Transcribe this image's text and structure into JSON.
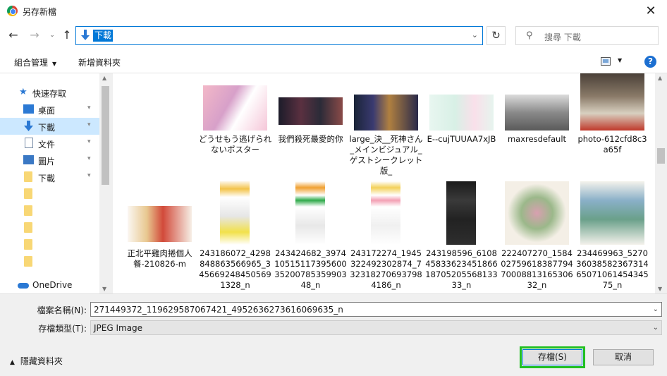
{
  "window": {
    "title": "另存新檔",
    "close_glyph": "✕"
  },
  "nav": {
    "back_glyph": "←",
    "forward_glyph": "→",
    "dropdown_glyph": "⌄",
    "up_glyph": "↑",
    "address": "下載",
    "address_chevron": "⌄",
    "refresh_glyph": "↻",
    "search_icon": "⚲",
    "search_placeholder": "搜尋 下載"
  },
  "toolbar": {
    "organize_label": "組合管理",
    "organize_caret": "▼",
    "new_folder_label": "新增資料夾",
    "view_caret": "▼",
    "help_glyph": "?"
  },
  "sidebar": {
    "items": [
      {
        "label": "快速存取",
        "icon": "star-icon",
        "pinned": false
      },
      {
        "label": "桌面",
        "icon": "desktop-icon",
        "pinned": true
      },
      {
        "label": "下載",
        "icon": "download-icon",
        "pinned": true,
        "selected": true
      },
      {
        "label": "文件",
        "icon": "document-icon",
        "pinned": true
      },
      {
        "label": "圖片",
        "icon": "picture-icon",
        "pinned": true
      },
      {
        "label": "下載",
        "icon": "folder-icon",
        "pinned": true
      },
      {
        "label": "",
        "icon": "folder-icon"
      },
      {
        "label": "",
        "icon": "folder-icon"
      },
      {
        "label": "",
        "icon": "folder-icon"
      },
      {
        "label": "",
        "icon": "folder-icon"
      },
      {
        "label": "",
        "icon": "folder-icon"
      },
      {
        "label": "OneDrive",
        "icon": "cloud-icon"
      }
    ],
    "pin_glyph": "📌"
  },
  "files": {
    "row1": [
      {
        "name": "どうせもう逃げられないポスター"
      },
      {
        "name": "我們殺死最愛的你"
      },
      {
        "name": "large_決__死神さん_メインビジュアル_ゲストシークレット版_"
      },
      {
        "name": "E--cujTUUAA7xJB"
      },
      {
        "name": "maxresdefault"
      },
      {
        "name": "photo-612cfd8c3a65f"
      }
    ],
    "row2": [
      {
        "name": "正北平雞肉捲個人餐-210826-m"
      },
      {
        "name": "243186072_4298848863566965_3456692484505691328_n"
      },
      {
        "name": "243424682_3974105151173956003520078535990348_n"
      },
      {
        "name": "243172274_1945322492302874_7323182706937984186_n"
      },
      {
        "name": "243198596_6108458336234518661870520556813333_n"
      },
      {
        "name": "222407270_1584027596183877947000881316530632_n"
      },
      {
        "name": "234469963_5270360385823673146507106145434575_n"
      }
    ]
  },
  "footer": {
    "filename_label": "檔案名稱(N):",
    "filename_value": "271449372_119629587067421_4952636273616069635_n",
    "filetype_label": "存檔類型(T):",
    "filetype_value": "JPEG Image",
    "hide_folders_label": "隱藏資料夾",
    "save_label": "存檔(S)",
    "cancel_label": "取消",
    "chevron": "⌄"
  }
}
